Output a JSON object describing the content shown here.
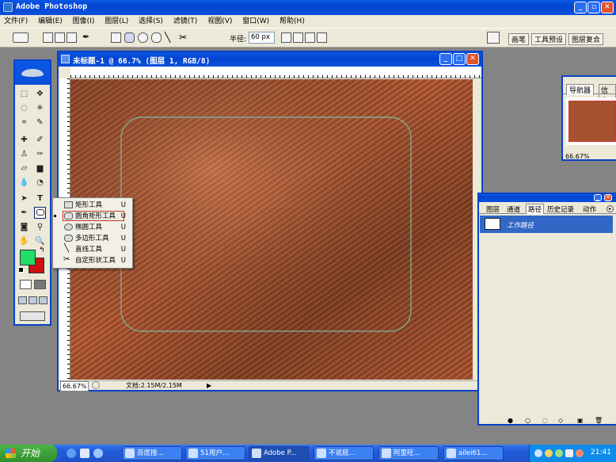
{
  "app": {
    "title": "Adobe Photoshop"
  },
  "menu": [
    "文件(F)",
    "编辑(E)",
    "图像(I)",
    "图层(L)",
    "选择(S)",
    "滤镜(T)",
    "视图(V)",
    "窗口(W)",
    "帮助(H)"
  ],
  "options": {
    "radius_label": "半径:",
    "radius_value": "60 px"
  },
  "palette_well": [
    "画笔",
    "工具预设",
    "图层复合"
  ],
  "document": {
    "title": "未标题-1 @ 66.7% (图层 1, RGB/8)",
    "zoom": "66.67%",
    "doc_size": "文档:2.15M/2.15M"
  },
  "navigator": {
    "tabs": [
      "导航器",
      "信息"
    ],
    "zoom": "66.67%"
  },
  "paths_panel": {
    "tabs": [
      "图层",
      "通道",
      "路径",
      "历史记录",
      "动作"
    ],
    "active_tab": "路径",
    "items": [
      "工作路径"
    ]
  },
  "shape_flyout": [
    {
      "label": "矩形工具",
      "key": "U",
      "icon": "rectangle-icon"
    },
    {
      "label": "圆角矩形工具",
      "key": "U",
      "icon": "rounded-rectangle-icon",
      "selected": true
    },
    {
      "label": "椭圆工具",
      "key": "U",
      "icon": "ellipse-icon"
    },
    {
      "label": "多边形工具",
      "key": "U",
      "icon": "polygon-icon"
    },
    {
      "label": "直线工具",
      "key": "U",
      "icon": "line-icon"
    },
    {
      "label": "自定形状工具",
      "key": "U",
      "icon": "custom-shape-icon"
    }
  ],
  "colors": {
    "foreground": "#22dd66",
    "background": "#cc1111",
    "texture_base": "#a2502f",
    "path_stroke": "#7fb8a4"
  },
  "taskbar": {
    "start": "开始",
    "tasks": [
      "百度搜...",
      "51用户...",
      "Adobe P...",
      "不说屁...",
      "阿里旺...",
      "ailei61..."
    ],
    "clock": "21:41"
  }
}
